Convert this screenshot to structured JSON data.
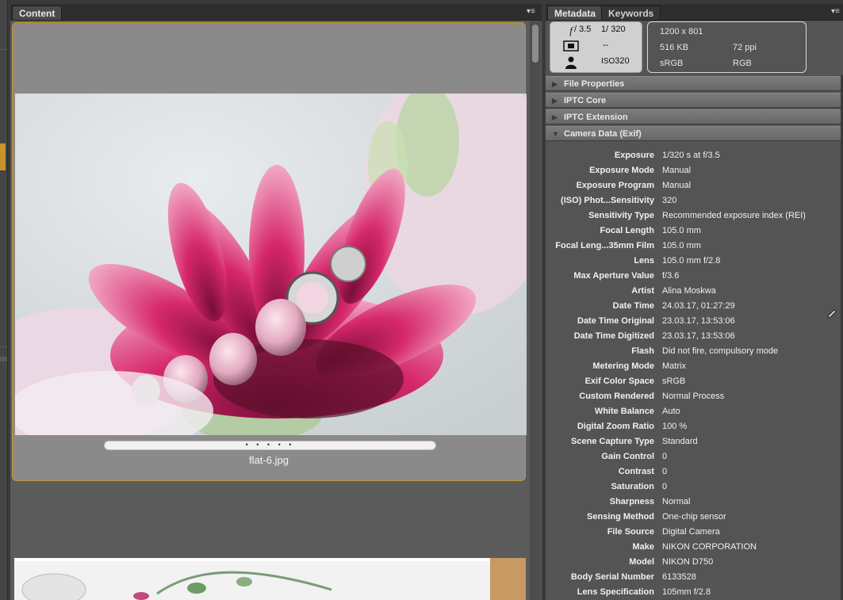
{
  "content_panel": {
    "tab_label": "Content",
    "menu_icon": "panel-menu-icon"
  },
  "thumbnail": {
    "filename": "flat-6.jpg",
    "rating_dots": "• • • • •"
  },
  "metadata_panel": {
    "tabs": [
      {
        "label": "Metadata"
      },
      {
        "label": "Keywords"
      }
    ],
    "camera": {
      "aperture_symbol": "f",
      "aperture_value": "/ 3.5",
      "shutter": "1/ 320",
      "metering": "--",
      "iso_label": "ISO",
      "iso_value": "320"
    },
    "file_info": {
      "dimensions": "1200 x 801",
      "size": "516 KB",
      "resolution": "72 ppi",
      "color_profile": "sRGB",
      "color_mode": "RGB"
    },
    "sections": [
      {
        "label": "File Properties"
      },
      {
        "label": "IPTC Core"
      },
      {
        "label": "IPTC Extension"
      },
      {
        "label": "Camera Data (Exif)"
      }
    ],
    "exif": [
      {
        "key": "Exposure",
        "value": "1/320 s at f/3.5"
      },
      {
        "key": "Exposure Mode",
        "value": "Manual"
      },
      {
        "key": "Exposure Program",
        "value": "Manual"
      },
      {
        "key": "(ISO) Phot...Sensitivity",
        "value": "320"
      },
      {
        "key": "Sensitivity Type",
        "value": "Recommended exposure index (REI)"
      },
      {
        "key": "Focal Length",
        "value": "105.0 mm"
      },
      {
        "key": "Focal Leng...35mm Film",
        "value": "105.0 mm"
      },
      {
        "key": "Lens",
        "value": "105.0 mm f/2.8"
      },
      {
        "key": "Max Aperture Value",
        "value": "f/3.6"
      },
      {
        "key": "Artist",
        "value": "Alina Moskwa"
      },
      {
        "key": "Date Time",
        "value": "24.03.17, 01:27:29"
      },
      {
        "key": "Date Time Original",
        "value": "23.03.17, 13:53:06"
      },
      {
        "key": "Date Time Digitized",
        "value": "23.03.17, 13:53:06"
      },
      {
        "key": "Flash",
        "value": "Did not fire, compulsory mode"
      },
      {
        "key": "Metering Mode",
        "value": "Matrix"
      },
      {
        "key": "Exif Color Space",
        "value": "sRGB"
      },
      {
        "key": "Custom Rendered",
        "value": "Normal Process"
      },
      {
        "key": "White Balance",
        "value": "Auto"
      },
      {
        "key": "Digital Zoom Ratio",
        "value": "100 %"
      },
      {
        "key": "Scene Capture Type",
        "value": "Standard"
      },
      {
        "key": "Gain Control",
        "value": "0"
      },
      {
        "key": "Contrast",
        "value": "0"
      },
      {
        "key": "Saturation",
        "value": "0"
      },
      {
        "key": "Sharpness",
        "value": "Normal"
      },
      {
        "key": "Sensing Method",
        "value": "One-chip sensor"
      },
      {
        "key": "File Source",
        "value": "Digital Camera"
      },
      {
        "key": "Make",
        "value": "NIKON CORPORATION"
      },
      {
        "key": "Model",
        "value": "NIKON D750"
      },
      {
        "key": "Body Serial Number",
        "value": "6133528"
      },
      {
        "key": "Lens Specification",
        "value": "105mm f/2.8"
      }
    ]
  },
  "colors": {
    "accent": "#c7952e",
    "panel_bg": "#5b5b5b",
    "section_bg": "#6f6f6f"
  }
}
